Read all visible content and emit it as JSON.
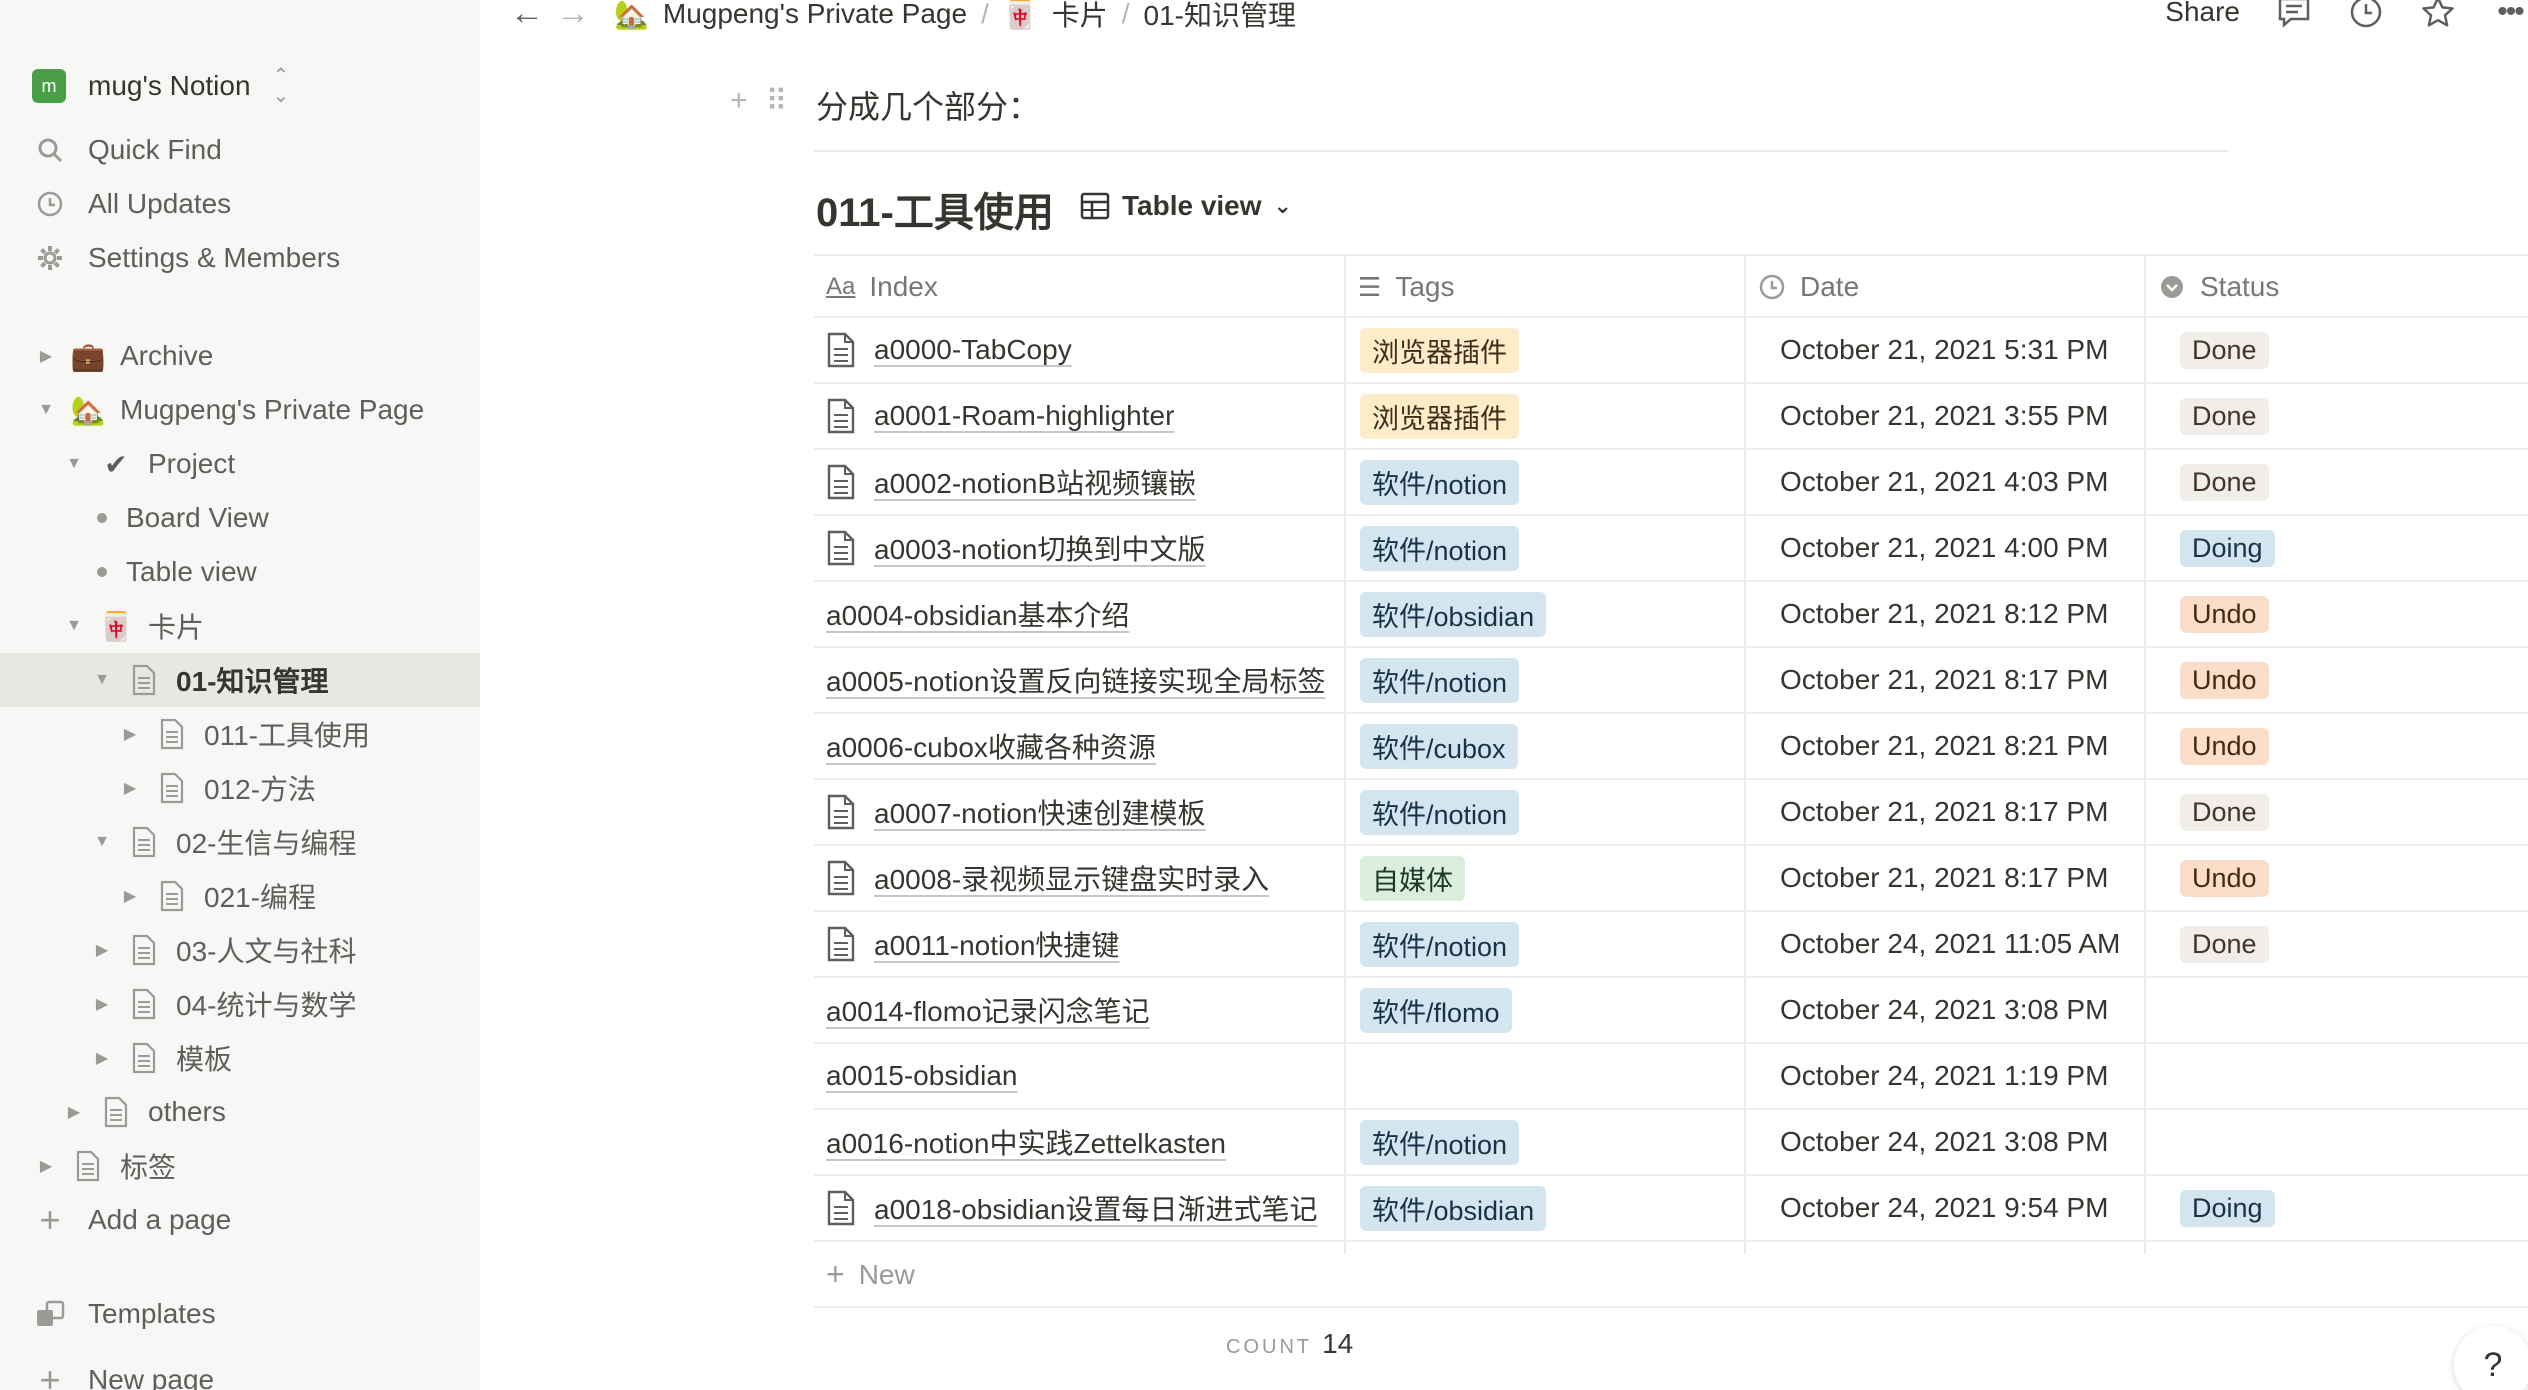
{
  "window": {
    "traffic_colors": [
      "#ff5f57",
      "#febc2e",
      "#28c840"
    ]
  },
  "sidebar": {
    "workspace": {
      "avatar": "m",
      "name": "mug's Notion",
      "avatar_color": "#4a9e47"
    },
    "top_items": [
      {
        "label": "Quick Find",
        "icon": "search-icon"
      },
      {
        "label": "All Updates",
        "icon": "clock-icon"
      },
      {
        "label": "Settings & Members",
        "icon": "gear-icon"
      }
    ],
    "tree": [
      {
        "label": "Archive",
        "icon": "briefcase-emoji",
        "glyph": "💼",
        "expanded": false
      },
      {
        "label": "Mugpeng's Private Page",
        "icon": "house-emoji",
        "glyph": "🏡",
        "expanded": true
      },
      {
        "label": "Project",
        "icon": "checkmark-emoji",
        "glyph": "✔",
        "expanded": true
      },
      {
        "label": "Board View",
        "icon": "bullet"
      },
      {
        "label": "Table view",
        "icon": "bullet"
      },
      {
        "label": "卡片",
        "icon": "mahjong-emoji",
        "glyph": "🀄",
        "expanded": true
      },
      {
        "label": "01-知识管理",
        "icon": "page-icon",
        "expanded": true,
        "active": true
      },
      {
        "label": "011-工具使用",
        "icon": "page-icon",
        "expanded": false
      },
      {
        "label": "012-方法",
        "icon": "page-icon",
        "expanded": false
      },
      {
        "label": "02-生信与编程",
        "icon": "page-icon",
        "expanded": true
      },
      {
        "label": "021-编程",
        "icon": "page-icon",
        "expanded": false
      },
      {
        "label": "03-人文与社科",
        "icon": "page-icon",
        "expanded": false
      },
      {
        "label": "04-统计与数学",
        "icon": "page-icon",
        "expanded": false
      },
      {
        "label": "模板",
        "icon": "page-icon",
        "expanded": false
      },
      {
        "label": "others",
        "icon": "page-icon",
        "expanded": false
      },
      {
        "label": "标签",
        "icon": "page-icon",
        "expanded": false
      }
    ],
    "add_page": "Add a page",
    "templates": "Templates",
    "new_page": "New page"
  },
  "topbar": {
    "breadcrumbs": [
      {
        "label": "Mugpeng's Private Page",
        "glyph": "🏡"
      },
      {
        "label": "卡片",
        "glyph": "🀄"
      },
      {
        "label": "01-知识管理",
        "glyph": ""
      }
    ],
    "share": "Share"
  },
  "main": {
    "block_text": "分成几个部分：",
    "database": {
      "title": "011-工具使用",
      "view_name": "Table view",
      "columns": [
        {
          "label": "Index",
          "icon": "text-aa-icon"
        },
        {
          "label": "Tags",
          "icon": "list-icon"
        },
        {
          "label": "Date",
          "icon": "clock-icon"
        },
        {
          "label": "Status",
          "icon": "status-icon"
        }
      ],
      "rows": [
        {
          "index": "a0000-TabCopy",
          "has_icon": true,
          "tag": "浏览器插件",
          "date": "October 21, 2021 5:31 PM",
          "status": "Done"
        },
        {
          "index": "a0001-Roam-highlighter",
          "has_icon": true,
          "tag": "浏览器插件",
          "date": "October 21, 2021 3:55 PM",
          "status": "Done"
        },
        {
          "index": "a0002-notionB站视频镶嵌",
          "has_icon": true,
          "tag": "软件/notion",
          "date": "October 21, 2021 4:03 PM",
          "status": "Done"
        },
        {
          "index": "a0003-notion切换到中文版",
          "has_icon": true,
          "tag": "软件/notion",
          "date": "October 21, 2021 4:00 PM",
          "status": "Doing"
        },
        {
          "index": "a0004-obsidian基本介绍",
          "has_icon": false,
          "tag": "软件/obsidian",
          "date": "October 21, 2021 8:12 PM",
          "status": "Undo"
        },
        {
          "index": "a0005-notion设置反向链接实现全局标签",
          "has_icon": false,
          "tag": "软件/notion",
          "date": "October 21, 2021 8:17 PM",
          "status": "Undo"
        },
        {
          "index": "a0006-cubox收藏各种资源",
          "has_icon": false,
          "tag": "软件/cubox",
          "date": "October 21, 2021 8:21 PM",
          "status": "Undo"
        },
        {
          "index": "a0007-notion快速创建模板",
          "has_icon": true,
          "tag": "软件/notion",
          "date": "October 21, 2021 8:17 PM",
          "status": "Done"
        },
        {
          "index": "a0008-录视频显示键盘实时录入",
          "has_icon": true,
          "tag": "自媒体",
          "date": "October 21, 2021 8:17 PM",
          "status": "Undo"
        },
        {
          "index": "a0011-notion快捷键",
          "has_icon": true,
          "tag": "软件/notion",
          "date": "October 24, 2021 11:05 AM",
          "status": "Done"
        },
        {
          "index": "a0014-flomo记录闪念笔记",
          "has_icon": false,
          "tag": "软件/flomo",
          "date": "October 24, 2021 3:08 PM",
          "status": ""
        },
        {
          "index": "a0015-obsidian",
          "has_icon": false,
          "tag": "",
          "date": "October 24, 2021 1:19 PM",
          "status": ""
        },
        {
          "index": "a0016-notion中实践Zettelkasten",
          "has_icon": false,
          "tag": "软件/notion",
          "date": "October 24, 2021 3:08 PM",
          "status": ""
        },
        {
          "index": "a0018-obsidian设置每日渐进式笔记",
          "has_icon": true,
          "tag": "软件/obsidian",
          "date": "October 24, 2021 9:54 PM",
          "status": "Doing"
        }
      ],
      "new_label": "New",
      "count_label": "COUNT",
      "count_value": "14"
    },
    "help": "?"
  },
  "colors": {
    "tag_browser": {
      "bg": "#fdecc8",
      "fg": "#402c1b"
    },
    "tag_software": {
      "bg": "#d3e5ef",
      "fg": "#183347"
    },
    "tag_media": {
      "bg": "#dbeddb",
      "fg": "#1c3829"
    },
    "status_done": {
      "bg": "#f1ede9",
      "fg": "#44342a"
    },
    "status_doing": {
      "bg": "#d3e5ef",
      "fg": "#183347"
    },
    "status_undo": {
      "bg": "#fadec9",
      "fg": "#49290e"
    }
  }
}
